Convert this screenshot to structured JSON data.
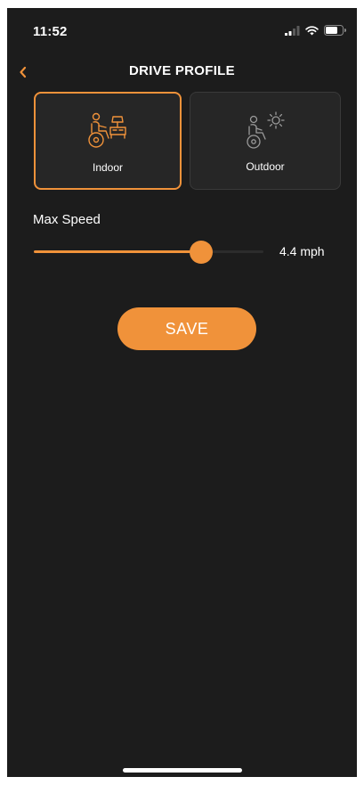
{
  "status_bar": {
    "time": "11:52",
    "icons": [
      "cellular-signal-icon",
      "wifi-icon",
      "battery-icon"
    ]
  },
  "header": {
    "back_icon": "chevron-left-icon",
    "title": "DRIVE PROFILE"
  },
  "profiles": [
    {
      "label": "Indoor",
      "icon": "wheelchair-indoor-icon",
      "selected": true
    },
    {
      "label": "Outdoor",
      "icon": "wheelchair-outdoor-icon",
      "selected": false
    }
  ],
  "max_speed": {
    "label": "Max Speed",
    "value_text": "4.4 mph",
    "fill_fraction": 0.73
  },
  "save": {
    "label": "SAVE"
  },
  "colors": {
    "accent": "#f0923a",
    "background": "#1c1c1c",
    "card": "#262626",
    "text": "#ffffff"
  }
}
